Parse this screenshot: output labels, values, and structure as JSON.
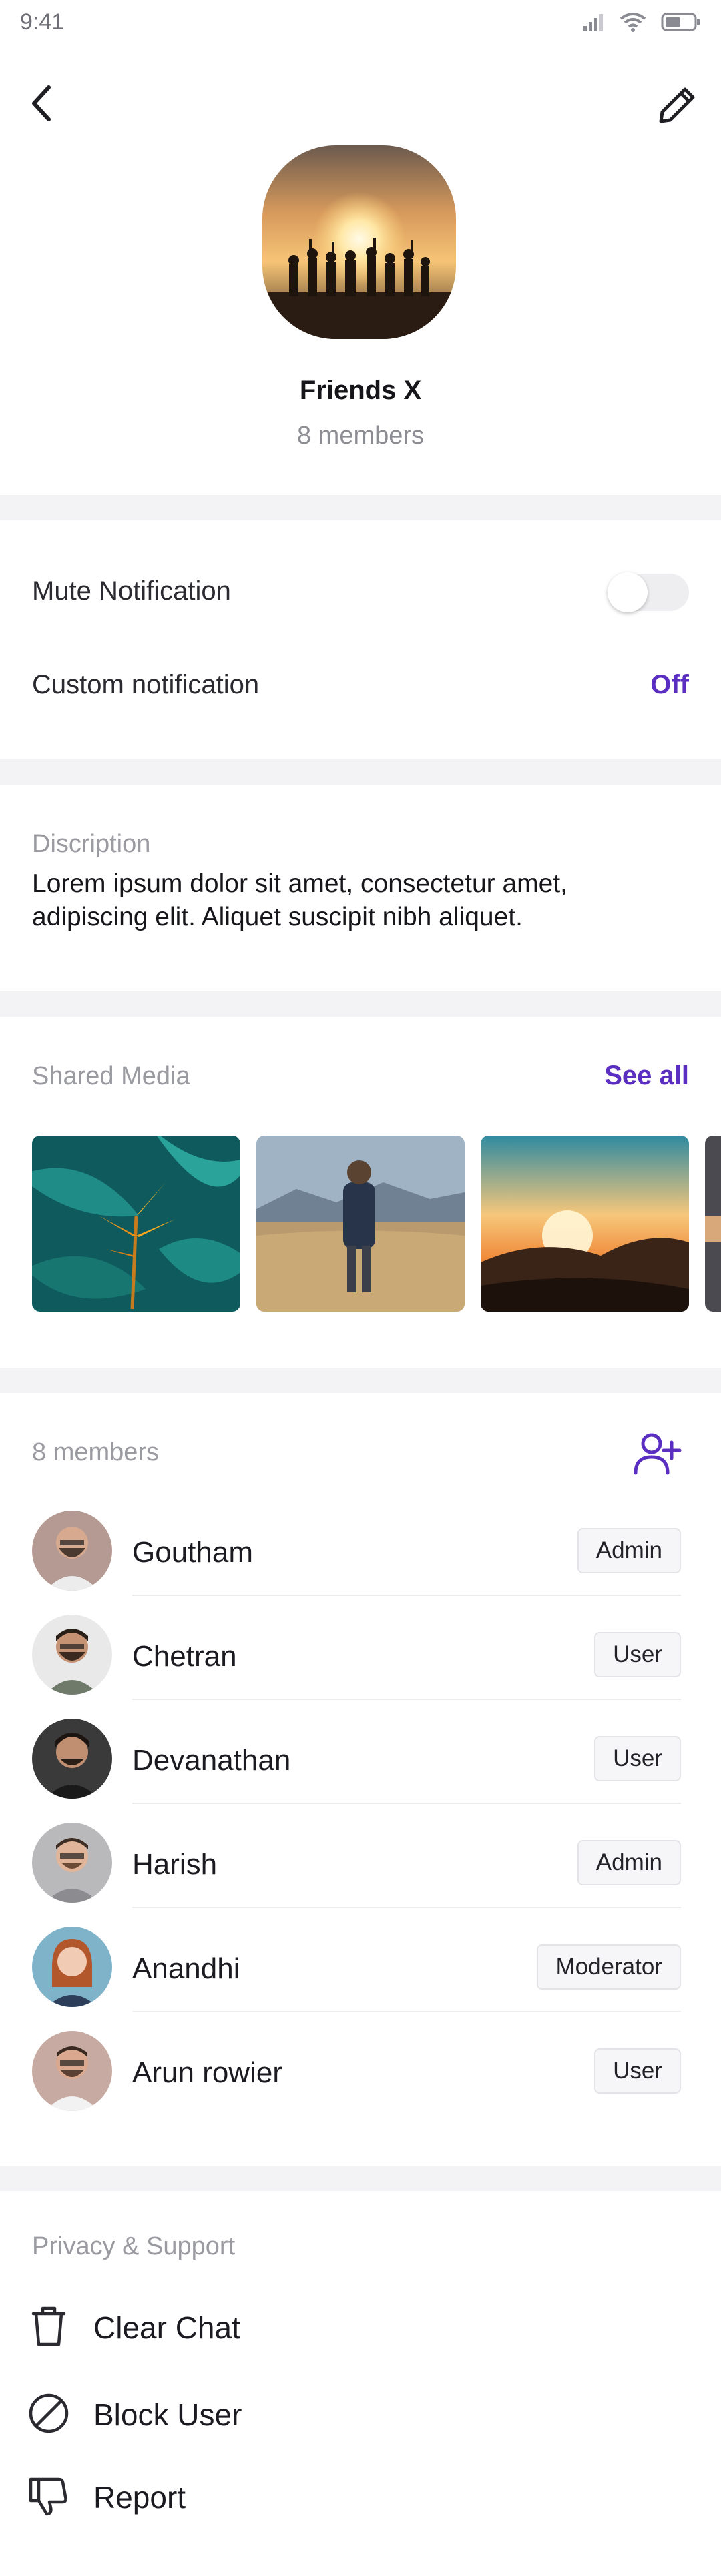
{
  "status_bar": {
    "time": "9:41"
  },
  "group": {
    "name": "Friends X",
    "member_count": "8 members"
  },
  "notifications": {
    "mute_label": "Mute Notification",
    "mute_enabled": false,
    "custom_label": "Custom notification",
    "custom_value": "Off"
  },
  "description": {
    "label": "Discription",
    "text": "Lorem ipsum dolor sit amet, consectetur amet, adipiscing elit. Aliquet suscipit nibh aliquet."
  },
  "shared_media": {
    "label": "Shared Media",
    "see_all": "See all"
  },
  "members": {
    "label": "8 members",
    "list": [
      {
        "name": "Goutham",
        "role": "Admin"
      },
      {
        "name": "Chetran",
        "role": "User"
      },
      {
        "name": "Devanathan",
        "role": "User"
      },
      {
        "name": "Harish",
        "role": "Admin"
      },
      {
        "name": "Anandhi",
        "role": "Moderator"
      },
      {
        "name": "Arun rowier",
        "role": "User"
      }
    ]
  },
  "privacy": {
    "label": "Privacy & Support",
    "items": [
      {
        "label": "Clear Chat",
        "icon": "trash-icon"
      },
      {
        "label": "Block User",
        "icon": "block-icon"
      },
      {
        "label": "Report",
        "icon": "thumbs-down-icon"
      }
    ]
  },
  "colors": {
    "accent": "#5b2ec2",
    "band": "#f3f3f5",
    "muted_text": "#9a9aa1"
  }
}
